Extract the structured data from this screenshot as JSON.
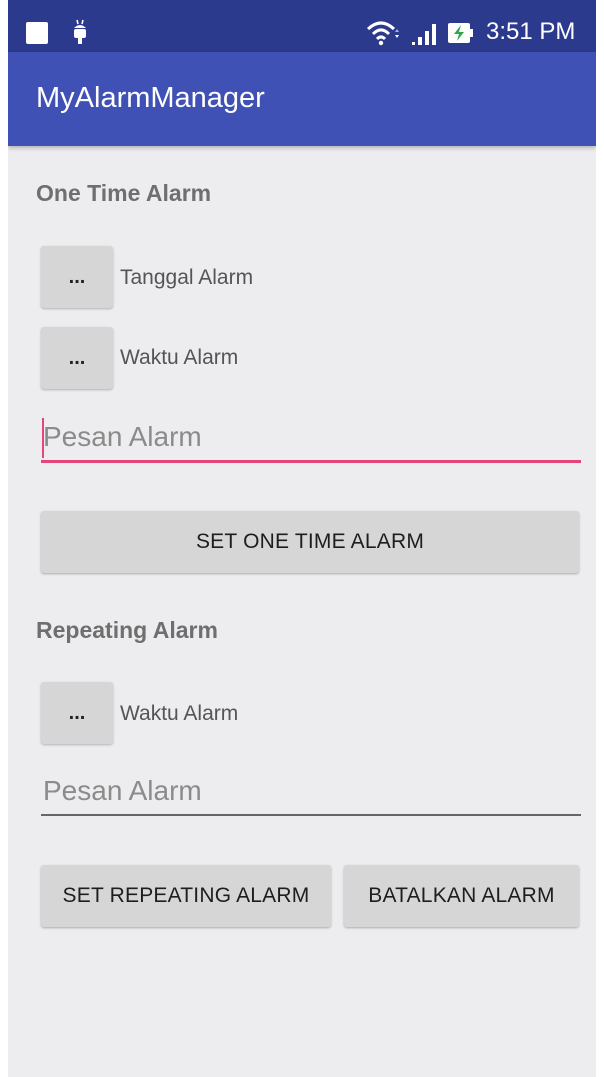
{
  "status_bar": {
    "time": "3:51 PM",
    "icons": [
      "notification-square-icon",
      "android-debug-icon",
      "wifi-icon",
      "signal-icon",
      "battery-charging-icon"
    ],
    "color": "#2c3a8e"
  },
  "app_bar": {
    "title": "MyAlarmManager",
    "color": "#3f51b5"
  },
  "one_time": {
    "heading": "One Time Alarm",
    "date_button": "...",
    "date_label": "Tanggal Alarm",
    "time_button": "...",
    "time_label": "Waktu Alarm",
    "message_placeholder": "Pesan Alarm",
    "set_button": "SET ONE TIME ALARM"
  },
  "repeating": {
    "heading": "Repeating Alarm",
    "time_button": "...",
    "time_label": "Waktu Alarm",
    "message_placeholder": "Pesan Alarm",
    "set_button": "SET REPEATING ALARM",
    "cancel_button": "BATALKAN ALARM"
  },
  "colors": {
    "accent": "#e6457a",
    "background": "#edecee",
    "button": "#d6d6d6"
  }
}
